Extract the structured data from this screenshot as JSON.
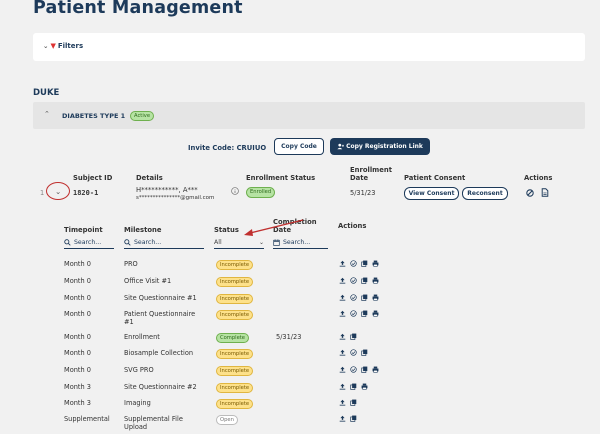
{
  "page_title": "Patient Management",
  "filters_label": "Filters",
  "site_name": "DUKE",
  "study": {
    "name": "DIABETES TYPE 1",
    "status": "Active"
  },
  "invite": {
    "label": "Invite Code: CRUIUO",
    "copy_code": "Copy Code",
    "copy_link": "Copy Registration Link"
  },
  "patient_headers": {
    "subject_id": "Subject ID",
    "details": "Details",
    "enrollment_status": "Enrollment Status",
    "enrollment_date_1": "Enrollment",
    "enrollment_date_2": "Date",
    "consent": "Patient Consent",
    "actions": "Actions"
  },
  "patient": {
    "index": "1",
    "subject_id": "1820-1",
    "name": "H***********, A***",
    "email": "s***************@gmail.com",
    "status": "Enrolled",
    "enrollment_date": "5/31/23",
    "view_consent": "View Consent",
    "reconsent": "Reconsent"
  },
  "milestone_headers": {
    "timepoint": "Timepoint",
    "milestone": "Milestone",
    "status": "Status",
    "completion_1": "Completion",
    "completion_2": "Date",
    "actions": "Actions"
  },
  "search_placeholder": "Search...",
  "status_filter": "All",
  "milestones": [
    {
      "timepoint": "Month 0",
      "milestone": "PRO",
      "milestone2": "",
      "status": "Incomplete",
      "date": ""
    },
    {
      "timepoint": "Month 0",
      "milestone": "Office Visit #1",
      "milestone2": "",
      "status": "Incomplete",
      "date": ""
    },
    {
      "timepoint": "Month 0",
      "milestone": "Site Questionnaire #1",
      "milestone2": "",
      "status": "Incomplete",
      "date": ""
    },
    {
      "timepoint": "Month 0",
      "milestone": "Patient Questionnaire",
      "milestone2": "#1",
      "status": "Incomplete",
      "date": ""
    },
    {
      "timepoint": "Month 0",
      "milestone": "Enrollment",
      "milestone2": "",
      "status": "Complete",
      "date": "5/31/23"
    },
    {
      "timepoint": "Month 0",
      "milestone": "Biosample Collection",
      "milestone2": "",
      "status": "Incomplete",
      "date": ""
    },
    {
      "timepoint": "Month 0",
      "milestone": "SVG PRO",
      "milestone2": "",
      "status": "Incomplete",
      "date": ""
    },
    {
      "timepoint": "Month 3",
      "milestone": "Site Questionnaire #2",
      "milestone2": "",
      "status": "Incomplete",
      "date": ""
    },
    {
      "timepoint": "Month 3",
      "milestone": "Imaging",
      "milestone2": "",
      "status": "Incomplete",
      "date": ""
    },
    {
      "timepoint": "Supplemental",
      "milestone": "Supplemental File",
      "milestone2": "Upload",
      "status": "Open",
      "date": ""
    }
  ],
  "colors": {
    "navy": "#1d3a5a",
    "annotation_red": "#c0302f"
  }
}
